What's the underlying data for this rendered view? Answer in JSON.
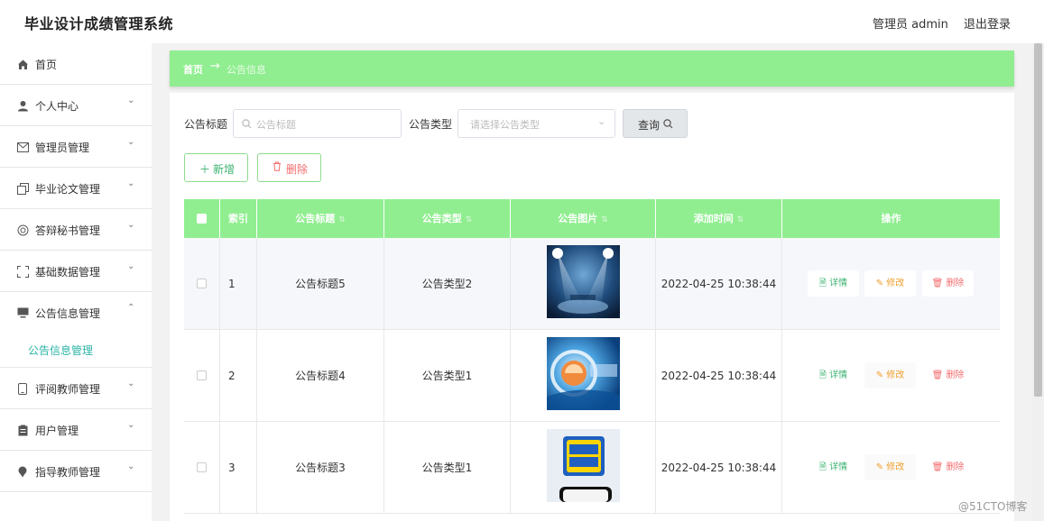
{
  "header": {
    "title": "毕业设计成绩管理系统",
    "user": "管理员 admin",
    "logout": "退出登录"
  },
  "sidebar": {
    "items": [
      {
        "label": "首页",
        "icon": "home-icon"
      },
      {
        "label": "个人中心",
        "icon": "user-icon"
      },
      {
        "label": "管理员管理",
        "icon": "mail-icon"
      },
      {
        "label": "毕业论文管理",
        "icon": "copy-icon"
      },
      {
        "label": "答辩秘书管理",
        "icon": "circle-icon"
      },
      {
        "label": "基础数据管理",
        "icon": "fullscreen-icon"
      },
      {
        "label": "公告信息管理",
        "icon": "monitor-icon"
      },
      {
        "label": "评阅教师管理",
        "icon": "phone-icon"
      },
      {
        "label": "用户管理",
        "icon": "clipboard-icon"
      },
      {
        "label": "指导教师管理",
        "icon": "pin-icon"
      }
    ],
    "active_sub": "公告信息管理"
  },
  "breadcrumb": {
    "home": "首页",
    "arrow": "→",
    "current": "公告信息"
  },
  "filters": {
    "title_label": "公告标题",
    "title_placeholder": "公告标题",
    "type_label": "公告类型",
    "type_placeholder": "请选择公告类型",
    "query_button": "查询"
  },
  "actions": {
    "add": "新增",
    "delete": "删除"
  },
  "table": {
    "columns": [
      "索引",
      "公告标题",
      "公告类型",
      "公告图片",
      "添加时间",
      "操作"
    ],
    "rows": [
      {
        "index": "1",
        "title": "公告标题5",
        "type": "公告类型2",
        "image": "stage-spotlight-news-image",
        "time": "2022-04-25 10:38:44"
      },
      {
        "index": "2",
        "title": "公告标题4",
        "type": "公告类型1",
        "image": "blue-news-globe-image",
        "time": "2022-04-25 10:38:44"
      },
      {
        "index": "3",
        "title": "公告标题3",
        "type": "公告类型1",
        "image": "hot-news-phone-image",
        "time": "2022-04-25 10:38:44"
      }
    ],
    "ops": {
      "detail": "详情",
      "edit": "修改",
      "remove": "删除"
    }
  },
  "watermark": "@51CTO博客",
  "colors": {
    "accent_green": "#90ee90",
    "link_teal": "#2bb5a6",
    "edit_orange": "#f0a030",
    "delete_red": "#f56c6c"
  }
}
